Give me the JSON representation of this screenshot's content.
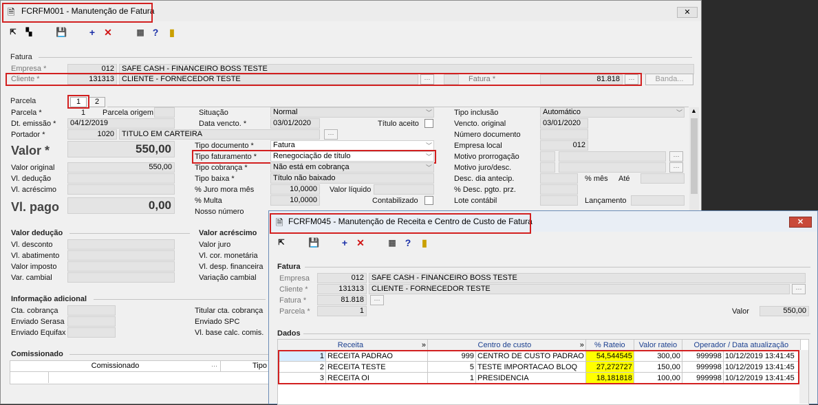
{
  "main": {
    "title": "FCRFM001 - Manutenção de Fatura",
    "fatura_section": "Fatura",
    "empresa": {
      "label": "Empresa *",
      "code": "012",
      "name": "SAFE CASH - FINANCEIRO BOSS TESTE"
    },
    "cliente": {
      "label": "Cliente *",
      "code": "131313",
      "name": "CLIENTE - FORNECEDOR TESTE"
    },
    "fatura": {
      "label": "Fatura *",
      "value": "81.818"
    },
    "banda_label": "Banda...",
    "parcela_section": "Parcela",
    "tabs": [
      "1",
      "2"
    ],
    "parcela": {
      "label": "Parcela *",
      "value": "1"
    },
    "parcela_origem": "Parcela origem",
    "dt_emissao": {
      "label": "Dt. emissão *",
      "value": "04/12/2019"
    },
    "portador": {
      "label": "Portador *",
      "code": "1020",
      "name": "TITULO EM CARTEIRA"
    },
    "valor": {
      "label": "Valor *",
      "value": "550,00"
    },
    "valor_original": {
      "label": "Valor original",
      "value": "550,00"
    },
    "vl_deducao": "Vl. dedução",
    "vl_acrescimo": "Vl. acréscimo",
    "vl_pago": {
      "label": "Vl. pago",
      "value": "0,00"
    },
    "situacao": {
      "label": "Situação",
      "value": "Normal"
    },
    "data_vencto": {
      "label": "Data vencto. *",
      "value": "03/01/2020"
    },
    "titulo_aceito": "Título aceito",
    "tipo_documento": {
      "label": "Tipo documento *",
      "value": "Fatura"
    },
    "tipo_faturamento": {
      "label": "Tipo faturamento *",
      "value": "Renegociação de título"
    },
    "tipo_cobranca": {
      "label": "Tipo cobrança *",
      "value": "Não está em cobrança"
    },
    "tipo_baixa": {
      "label": "Tipo baixa *",
      "value": "Título não baixado"
    },
    "juro_mora": {
      "label": "% Juro mora mês",
      "value": "10,0000"
    },
    "valor_liquido": "Valor líquido",
    "multa": {
      "label": "% Multa",
      "value": "10,0000"
    },
    "contabilizado": "Contabilizado",
    "nosso_numero": "Nosso número",
    "tipo_inclusao": {
      "label": "Tipo inclusão",
      "value": "Automático"
    },
    "vencto_original": {
      "label": "Vencto. original",
      "value": "03/01/2020"
    },
    "numero_documento": "Número documento",
    "empresa_local": {
      "label": "Empresa local",
      "value": "012"
    },
    "motivo_prorrogacao": "Motivo prorrogação",
    "motivo_juro": "Motivo juro/desc.",
    "desc_dia_antecip": "Desc. dia antecip.",
    "pct_mes": "% mês",
    "ate": "Até",
    "desc_pgto": "% Desc. pgto. prz.",
    "lote_contabil": "Lote contábil",
    "lancamento": "Lançamento",
    "valor_deducao_section": "Valor dedução",
    "deducao_items": [
      "Vl. desconto",
      "Vl. abatimento",
      "Valor imposto",
      "Var. cambial"
    ],
    "valor_acrescimo_section": "Valor acréscimo",
    "acrescimo_items": [
      "Valor juro",
      "Vl. cor. monetária",
      "Vl. desp. financeira",
      "Variação cambial"
    ],
    "info_section": "Informação adicional",
    "info_items": [
      "Cta. cobrança",
      "Enviado Serasa",
      "Enviado Equifax"
    ],
    "info_right": [
      "Titular cta. cobrança",
      "Enviado SPC",
      "Vl. base calc. comis."
    ],
    "comissionado_section": "Comissionado",
    "com_cols": [
      "Comissionado",
      "Tipo"
    ]
  },
  "popup": {
    "title": "FCRFM045 - Manutenção de Receita e Centro de Custo de Fatura",
    "fatura_section": "Fatura",
    "empresa": {
      "label": "Empresa",
      "code": "012",
      "name": "SAFE CASH - FINANCEIRO BOSS TESTE"
    },
    "cliente": {
      "label": "Cliente *",
      "code": "131313",
      "name": "CLIENTE - FORNECEDOR TESTE"
    },
    "fatura": {
      "label": "Fatura *",
      "value": "81.818"
    },
    "parcela": {
      "label": "Parcela *",
      "value": "1"
    },
    "valor": {
      "label": "Valor",
      "value": "550,00"
    },
    "dados_section": "Dados",
    "columns": [
      "Receita",
      "Centro de custo",
      "% Rateio",
      "Valor rateio",
      "Operador / Data atualização"
    ],
    "rows": [
      {
        "n": "1",
        "receita": "RECEITA PADRAO",
        "cc_code": "999",
        "cc_name": "CENTRO DE CUSTO PADRAO",
        "rateio": "54,544545",
        "valor": "300,00",
        "operador": "999998",
        "data": "10/12/2019 13:41:45"
      },
      {
        "n": "2",
        "receita": "RECEITA TESTE",
        "cc_code": "5",
        "cc_name": "TESTE IMPORTACAO BLOQ",
        "rateio": "27,272727",
        "valor": "150,00",
        "operador": "999998",
        "data": "10/12/2019 13:41:45"
      },
      {
        "n": "3",
        "receita": "RECEITA OI",
        "cc_code": "1",
        "cc_name": "PRESIDENCIA",
        "rateio": "18,181818",
        "valor": "100,00",
        "operador": "999998",
        "data": "10/12/2019 13:41:45"
      }
    ]
  },
  "colors": {
    "highlight": "#ffff00",
    "annotation": "#d21f1f",
    "close": "#c94a3a"
  }
}
